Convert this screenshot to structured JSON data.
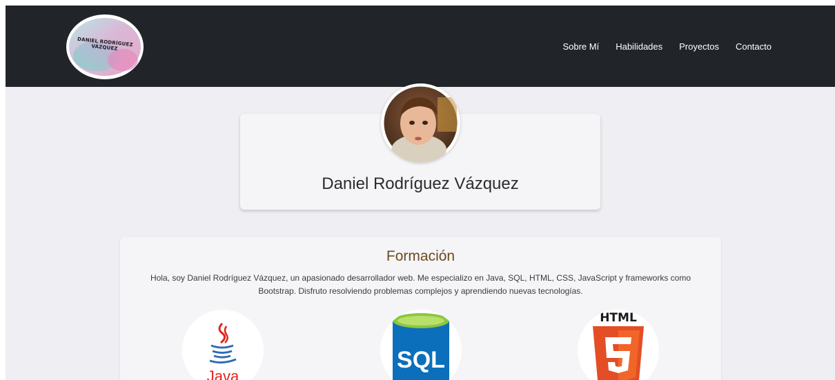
{
  "logo": {
    "text": "DANIEL RODRÍGUEZ VÁZQUEZ",
    "icon": "logo-badge"
  },
  "nav": {
    "items": [
      {
        "label": "Sobre Mí"
      },
      {
        "label": "Habilidades"
      },
      {
        "label": "Proyectos"
      },
      {
        "label": "Contacto"
      }
    ]
  },
  "profile": {
    "name": "Daniel Rodríguez Vázquez",
    "avatar_icon": "profile-photo"
  },
  "formacion": {
    "title": "Formación",
    "text": "Hola, soy Daniel Rodríguez Vázquez, un apasionado desarrollador web. Me especializo en Java, SQL, HTML, CSS, JavaScript y frameworks como Bootstrap. Disfruto resolviendo problemas complejos y aprendiendo nuevas tecnologías.",
    "technologies": [
      {
        "name": "java-logo",
        "label": "Java"
      },
      {
        "name": "sql-logo",
        "label": "SQL"
      },
      {
        "name": "html5-logo",
        "label": "HTML"
      }
    ]
  },
  "colors": {
    "navbar": "#212529",
    "page_bg": "#efeff3",
    "card_bg": "#f5f5f8",
    "title_color": "#6b4b1b",
    "java_red": "#e2231a",
    "java_blue": "#2f6db5",
    "sql_blue": "#0b6fbb",
    "sql_green": "#8cc63f",
    "html_orange": "#e44d26"
  }
}
